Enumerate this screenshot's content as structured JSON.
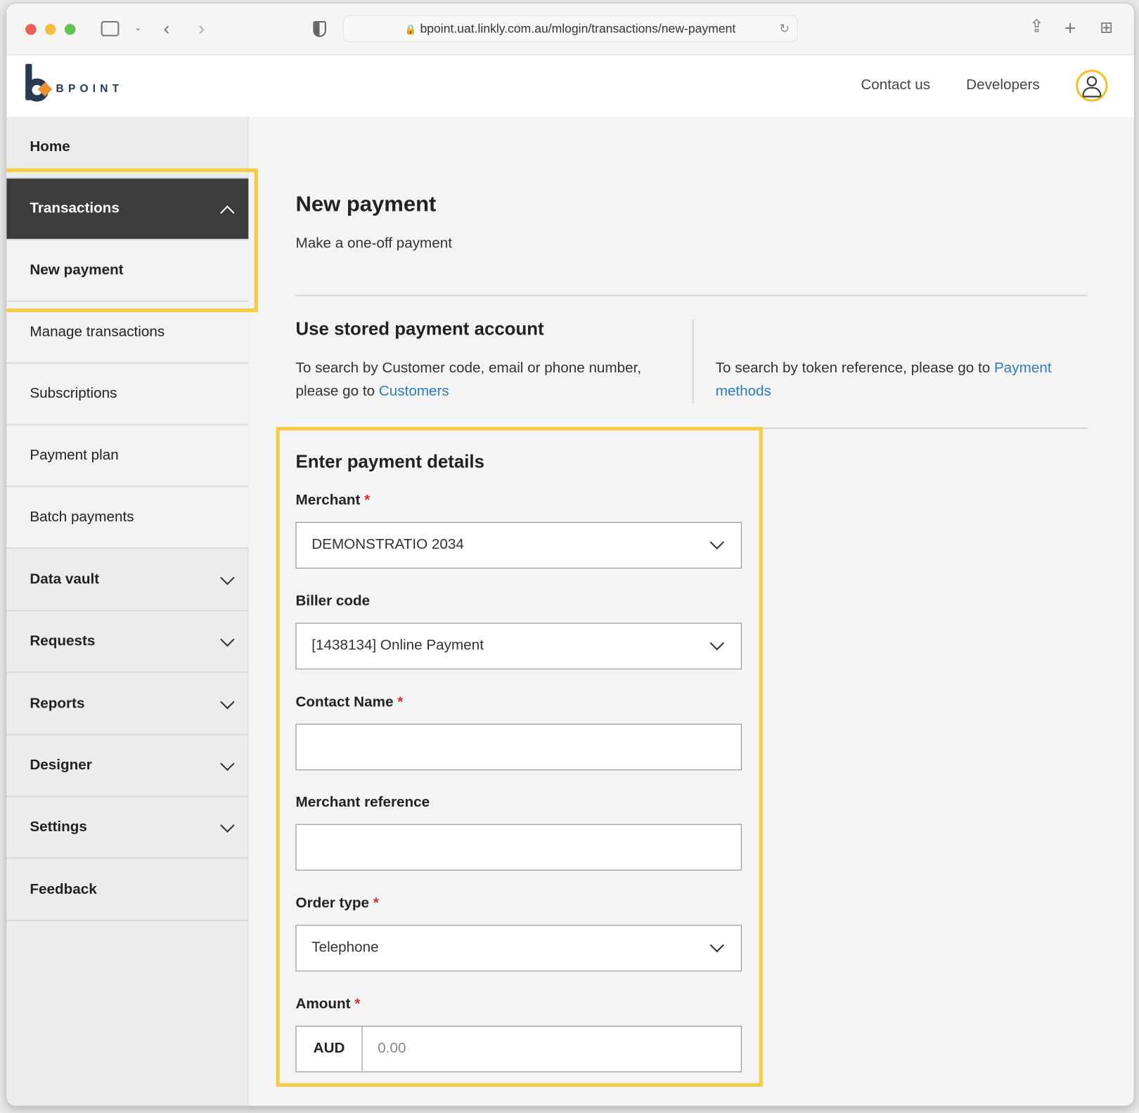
{
  "browser": {
    "url": "bpoint.uat.linkly.com.au/mlogin/transactions/new-payment"
  },
  "header": {
    "logo_text": "BPOINT",
    "links": [
      "Contact us",
      "Developers"
    ]
  },
  "sidebar": {
    "items": [
      {
        "label": "Home"
      },
      {
        "label": "Transactions"
      },
      {
        "label": "New payment"
      },
      {
        "label": "Manage transactions"
      },
      {
        "label": "Subscriptions"
      },
      {
        "label": "Payment plan"
      },
      {
        "label": "Batch payments"
      },
      {
        "label": "Data vault"
      },
      {
        "label": "Requests"
      },
      {
        "label": "Reports"
      },
      {
        "label": "Designer"
      },
      {
        "label": "Settings"
      },
      {
        "label": "Feedback"
      }
    ]
  },
  "page": {
    "title": "New payment",
    "subtitle": "Make a one-off payment"
  },
  "stored": {
    "heading": "Use stored payment account",
    "left_text": "To search by Customer code, email or phone number, please go to ",
    "left_link": "Customers",
    "right_text": "To search by token reference, please go to ",
    "right_link": "Payment methods"
  },
  "form": {
    "heading": "Enter payment details",
    "merchant_label": "Merchant",
    "merchant_value": "DEMONSTRATIO 2034",
    "biller_label": "Biller code",
    "biller_value": "[1438134] Online Payment",
    "contact_label": "Contact Name",
    "contact_value": "",
    "reference_label": "Merchant reference",
    "reference_value": "",
    "order_label": "Order type",
    "order_value": "Telephone",
    "amount_label": "Amount",
    "currency": "AUD",
    "amount_placeholder": "0.00",
    "required_mark": "*"
  },
  "colors": {
    "highlight": "#f7cc45",
    "link": "#2f7ac4",
    "active_nav": "#3c3c3c"
  }
}
